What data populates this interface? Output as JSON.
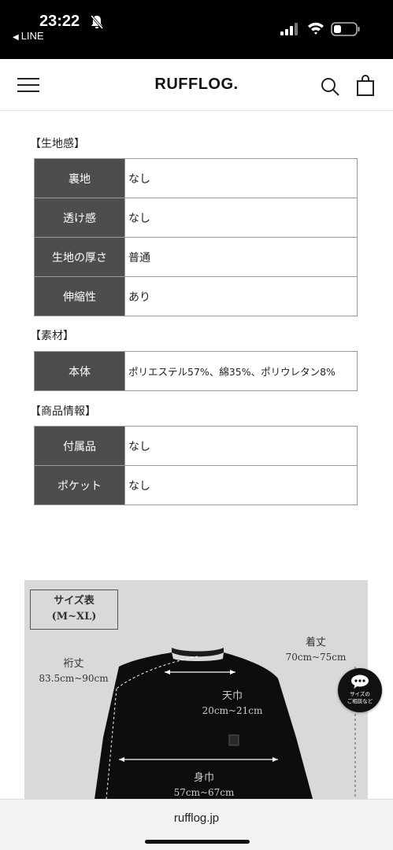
{
  "status_bar": {
    "time": "23:22",
    "back_app": "LINE",
    "icons": [
      "bell-muted-icon",
      "signal-icon",
      "wifi-icon",
      "battery-icon"
    ]
  },
  "header": {
    "logo": "RUFFLOG.",
    "icons": [
      "menu-icon",
      "search-icon",
      "shopping-bag-icon"
    ]
  },
  "fabric": {
    "title": "【生地感】",
    "rows": [
      {
        "key": "裏地",
        "value": "なし"
      },
      {
        "key": "透け感",
        "value": "なし"
      },
      {
        "key": "生地の厚さ",
        "value": "普通"
      },
      {
        "key": "伸縮性",
        "value": "あり"
      }
    ]
  },
  "material": {
    "title": "【素材】",
    "rows": [
      {
        "key": "本体",
        "value": "ポリエステル57%、綿35%、ポリウレタン8%"
      }
    ]
  },
  "product_info": {
    "title": "【商品情報】",
    "rows": [
      {
        "key": "付属品",
        "value": "なし"
      },
      {
        "key": "ポケット",
        "value": "なし"
      }
    ]
  },
  "size_chart": {
    "box_title": "サイズ表",
    "box_range": "(M~XL)",
    "sleeve": {
      "label": "裄丈",
      "value": "83.5cm~90cm"
    },
    "length": {
      "label": "着丈",
      "value": "70cm~75cm"
    },
    "neck_width": {
      "label": "天巾",
      "value": "20cm~21cm"
    },
    "body_width": {
      "label": "身巾",
      "value": "57cm~67cm"
    }
  },
  "consult_button": {
    "line1": "サイズの",
    "line2": "ご相談など",
    "icon": "chat-bubble-icon"
  },
  "url_bar": {
    "url": "rufflog.jp"
  },
  "colors": {
    "table_key_bg": "#4d4d4d",
    "chart_bg": "#d9d9d9",
    "status_bg": "#000000"
  }
}
